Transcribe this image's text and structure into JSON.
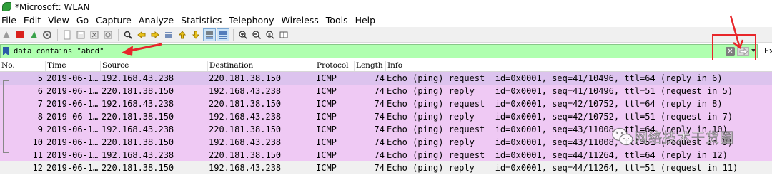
{
  "window": {
    "title": "*Microsoft: WLAN",
    "icon": "wireshark-fin-icon"
  },
  "menu": [
    "File",
    "Edit",
    "View",
    "Go",
    "Capture",
    "Analyze",
    "Statistics",
    "Telephony",
    "Wireless",
    "Tools",
    "Help"
  ],
  "toolbar": {
    "icons": [
      "shark-fin-start-icon",
      "stop-square-icon",
      "restart-shark-icon",
      "options-gear-icon",
      "open-file-icon",
      "save-file-icon",
      "close-file-icon",
      "reload-icon",
      "find-packet-icon",
      "go-back-icon",
      "go-forward-icon",
      "go-to-packet-icon",
      "first-packet-icon",
      "last-packet-icon",
      "auto-scroll-icon",
      "colorize-icon",
      "zoom-in-icon",
      "zoom-out-icon",
      "normal-size-icon",
      "resize-columns-icon"
    ]
  },
  "filter": {
    "value": "data contains \"abcd\"",
    "background": "#afffaf",
    "expression_label": "Ex"
  },
  "columns": [
    "No.",
    "Time",
    "Source",
    "Destination",
    "Protocol",
    "Length",
    "Info"
  ],
  "packets": [
    {
      "no": "5",
      "time": "2019-06-1…",
      "src": "192.168.43.238",
      "dst": "220.181.38.150",
      "proto": "ICMP",
      "len": "74",
      "info": "Echo (ping) request  id=0x0001, seq=41/10496, ttl=64 (reply in 6)"
    },
    {
      "no": "6",
      "time": "2019-06-1…",
      "src": "220.181.38.150",
      "dst": "192.168.43.238",
      "proto": "ICMP",
      "len": "74",
      "info": "Echo (ping) reply    id=0x0001, seq=41/10496, ttl=51 (request in 5)"
    },
    {
      "no": "7",
      "time": "2019-06-1…",
      "src": "192.168.43.238",
      "dst": "220.181.38.150",
      "proto": "ICMP",
      "len": "74",
      "info": "Echo (ping) request  id=0x0001, seq=42/10752, ttl=64 (reply in 8)"
    },
    {
      "no": "8",
      "time": "2019-06-1…",
      "src": "220.181.38.150",
      "dst": "192.168.43.238",
      "proto": "ICMP",
      "len": "74",
      "info": "Echo (ping) reply    id=0x0001, seq=42/10752, ttl=51 (request in 7)"
    },
    {
      "no": "9",
      "time": "2019-06-1…",
      "src": "192.168.43.238",
      "dst": "220.181.38.150",
      "proto": "ICMP",
      "len": "74",
      "info": "Echo (ping) request  id=0x0001, seq=43/11008, ttl=64 (reply in 10)"
    },
    {
      "no": "10",
      "time": "2019-06-1…",
      "src": "220.181.38.150",
      "dst": "192.168.43.238",
      "proto": "ICMP",
      "len": "74",
      "info": "Echo (ping) reply    id=0x0001, seq=43/11008, ttl=51 (request in 9)"
    },
    {
      "no": "11",
      "time": "2019-06-1…",
      "src": "192.168.43.238",
      "dst": "220.181.38.150",
      "proto": "ICMP",
      "len": "74",
      "info": "Echo (ping) request  id=0x0001, seq=44/11264, ttl=64 (reply in 12)"
    },
    {
      "no": "12",
      "time": "2019-06-1…",
      "src": "220.181.38.150",
      "dst": "192.168.43.238",
      "proto": "ICMP",
      "len": "74",
      "info": "Echo (ping) reply    id=0x0001, seq=44/11264, ttl=51 (request in 11)"
    }
  ],
  "watermark": "网络技术干货圈",
  "colors": {
    "icmp_row": "#efc9f4",
    "selected_row": "#f0f0f0",
    "annotation": "#e8262a"
  }
}
